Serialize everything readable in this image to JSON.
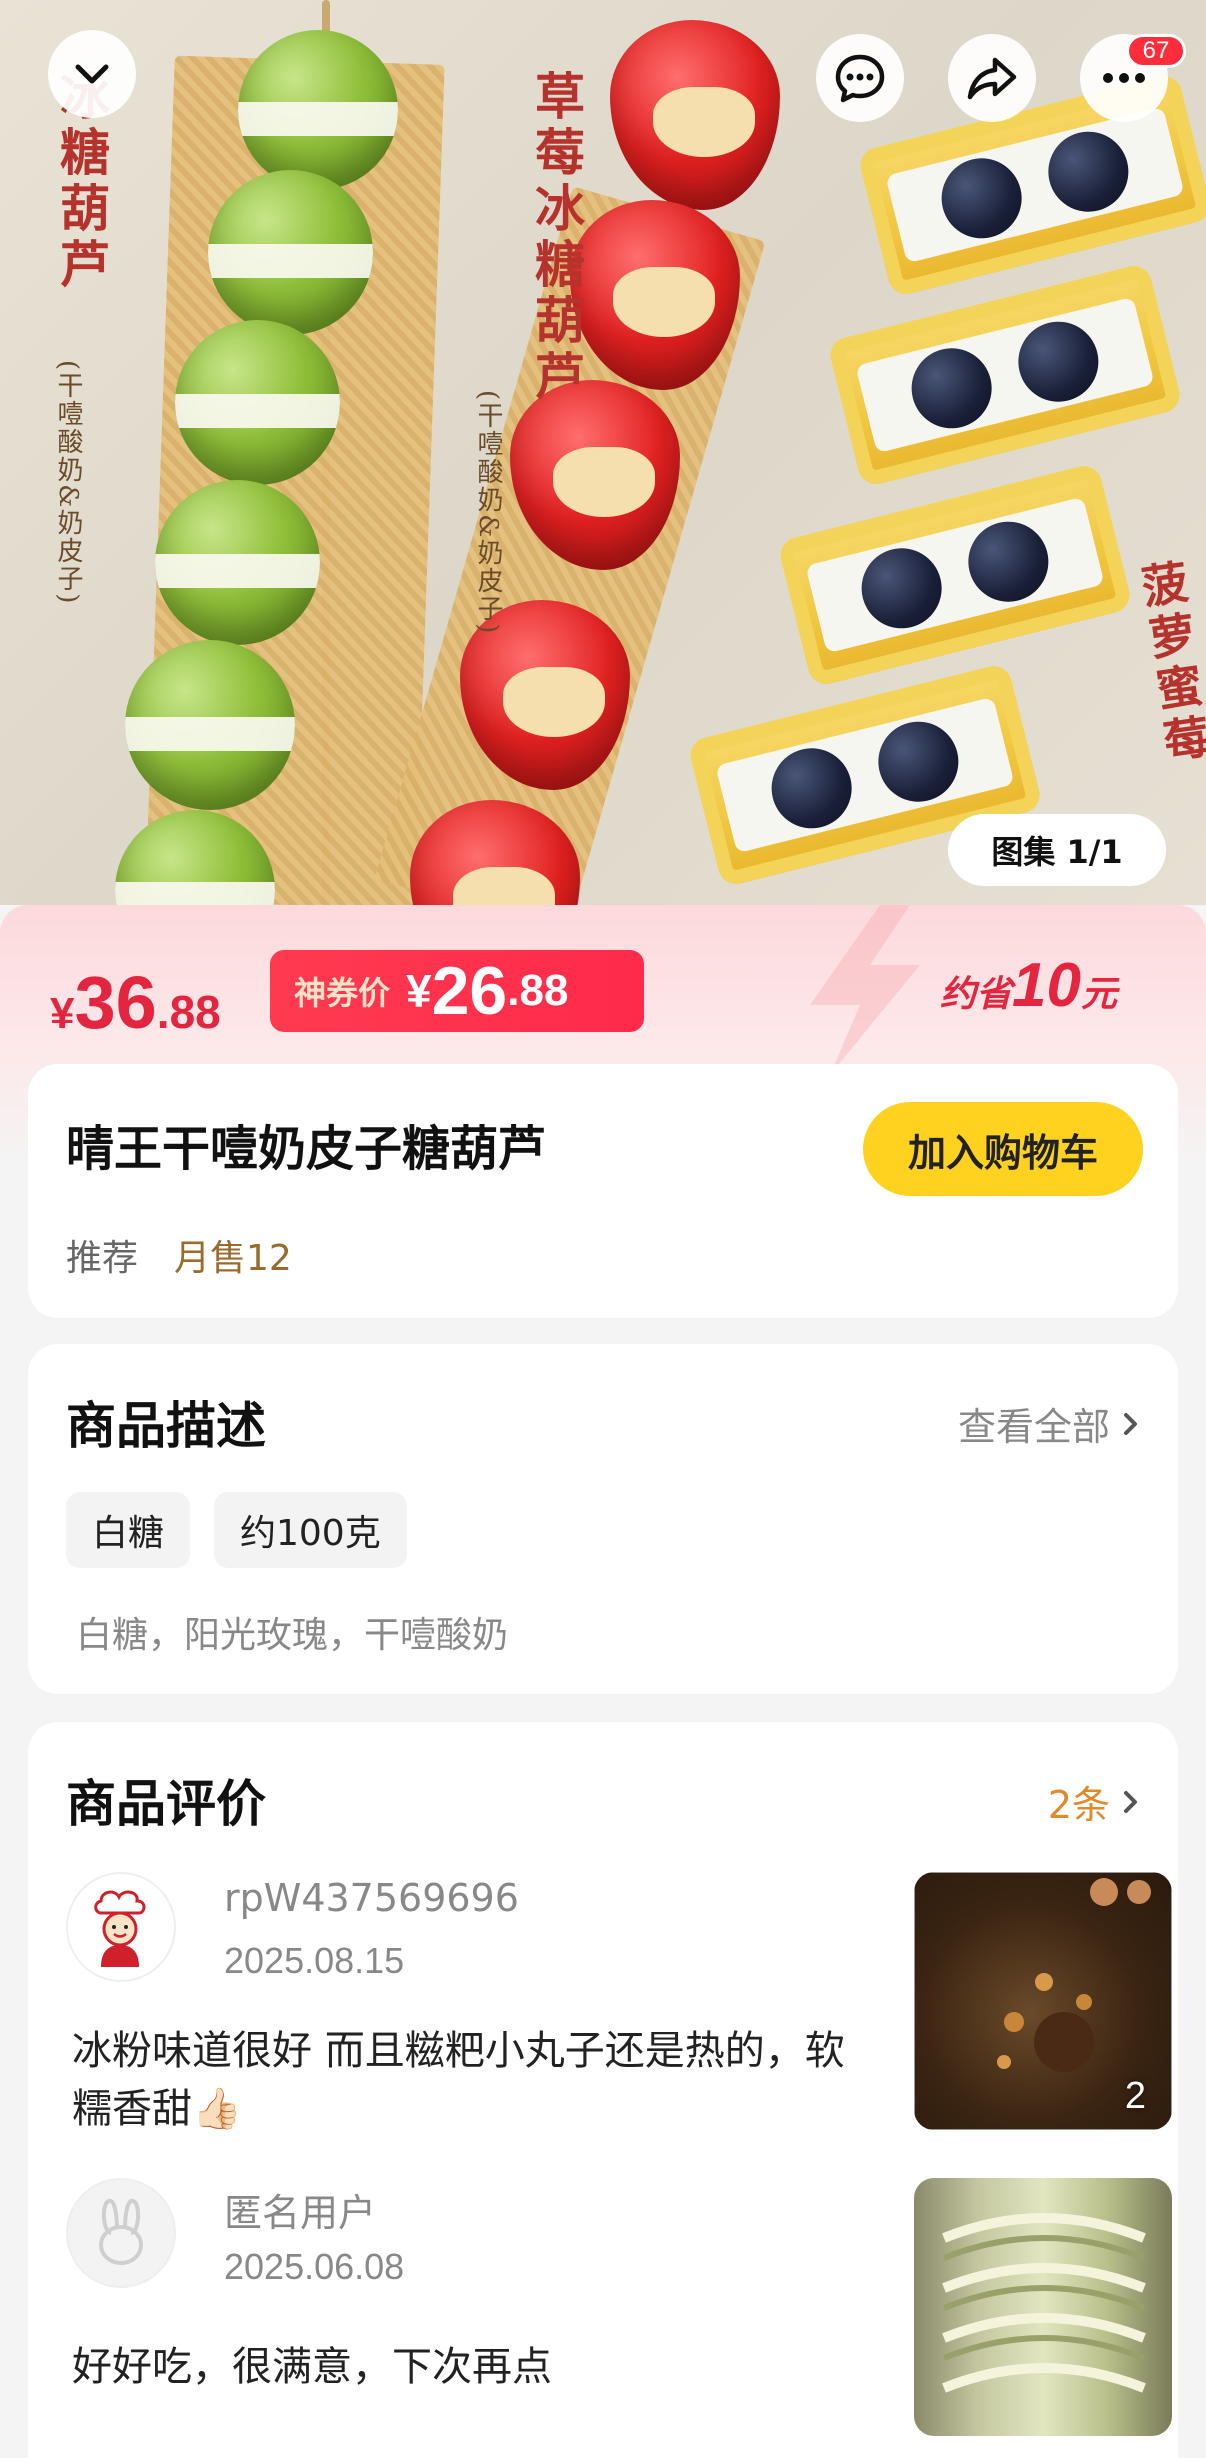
{
  "hero": {
    "labels": {
      "grape": "冰糖葫芦",
      "grape_sub": "(干噎酸奶&奶皮子)",
      "strawberry": "草莓冰糖葫芦",
      "strawberry_sub": "(干噎酸奶&奶皮子)",
      "pineapple": "菠萝蜜莓"
    },
    "notification_count": "67",
    "gallery_label": "图集 1/1"
  },
  "price": {
    "original_yen": "¥",
    "original_int": "36",
    "original_dec": ".88",
    "coupon_tag": "神券价",
    "coupon_yen": "¥",
    "coupon_int": "26",
    "coupon_dec": ".88",
    "save_prefix": "约省",
    "save_amount": "10",
    "save_suffix": "元"
  },
  "product": {
    "title": "晴王干噎奶皮子糖葫芦",
    "add_to_cart": "加入购物车",
    "recommend": "推荐",
    "monthly_sales": "月售12"
  },
  "description": {
    "title": "商品描述",
    "view_all": "查看全部",
    "chips": [
      "白糖",
      "约100克"
    ],
    "text": "白糖，阳光玫瑰，干噎酸奶"
  },
  "reviews": {
    "title": "商品评价",
    "count": "2条",
    "items": [
      {
        "user": "rpW437569696",
        "date": "2025.08.15",
        "text": "冰粉味道很好 而且糍粑小丸子还是热的，软糯香甜👍🏻",
        "image_count": "2"
      },
      {
        "user": "匿名用户",
        "date": "2025.06.08",
        "text": "好好吃，很满意，下次再点",
        "image_count": ""
      }
    ]
  },
  "colors": {
    "price_red": "#e4253f",
    "cart_yellow": "#ffd21f",
    "sales_brown": "#9a6b2d",
    "review_count_orange": "#e08a2a"
  }
}
